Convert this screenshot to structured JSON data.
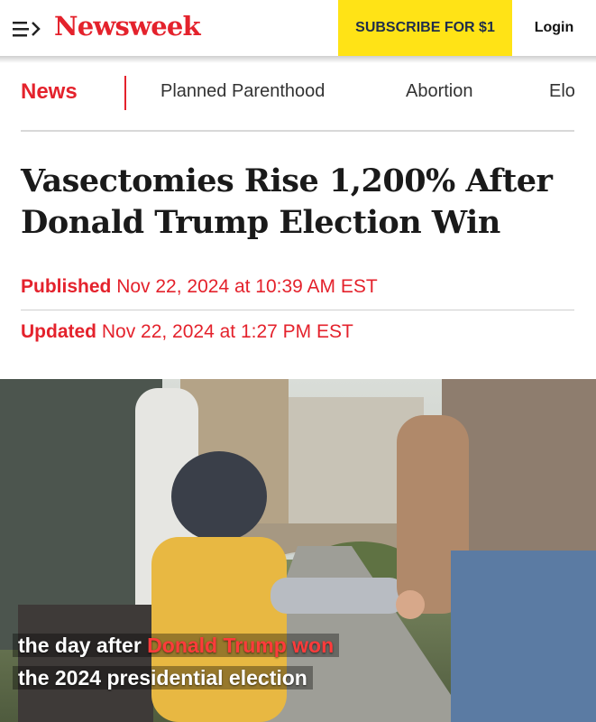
{
  "header": {
    "logo": "Newsweek",
    "subscribe_label": "SUBSCRIBE FOR $1",
    "login_label": "Login"
  },
  "nav": {
    "section": "News",
    "items": [
      "Planned Parenthood",
      "Abortion",
      "Elo"
    ]
  },
  "article": {
    "headline_line1": "Vasectomies Rise 1,200% After",
    "headline_line2": "Donald Trump Election Win",
    "published_label": "Published",
    "published_date": "Nov 22, 2024 at 10:39 AM EST",
    "updated_label": "Updated",
    "updated_date": "Nov 22, 2024 at 1:27 PM EST"
  },
  "image": {
    "caption_line1_a": "the day after ",
    "caption_line1_b": "Donald Trump won",
    "caption_line2": "the 2024 presidential election"
  },
  "colors": {
    "brand_red": "#e4222c",
    "subscribe_yellow": "#ffe316"
  }
}
